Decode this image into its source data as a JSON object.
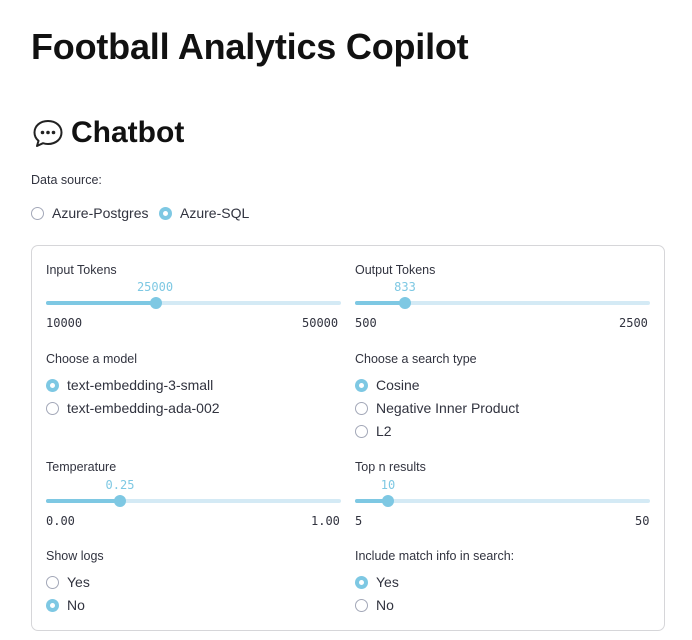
{
  "app_title": "Football Analytics Copilot",
  "section_title": "Chatbot",
  "section_icon": "speech-bubble-icon",
  "colors": {
    "accent": "#7ec8e3",
    "track": "#d4eaf5",
    "text": "#31333f",
    "border": "#d6d6d9"
  },
  "data_source": {
    "label": "Data source:",
    "options": [
      "Azure-Postgres",
      "Azure-SQL"
    ],
    "selected": "Azure-SQL"
  },
  "settings": {
    "input_tokens": {
      "label": "Input Tokens",
      "value": "25000",
      "min": "10000",
      "max": "50000",
      "fraction": 0.375
    },
    "output_tokens": {
      "label": "Output Tokens",
      "value": "833",
      "min": "500",
      "max": "2500",
      "fraction": 0.1665
    },
    "model": {
      "label": "Choose a model",
      "options": [
        "text-embedding-3-small",
        "text-embedding-ada-002"
      ],
      "selected": "text-embedding-3-small"
    },
    "search_type": {
      "label": "Choose a search type",
      "options": [
        "Cosine",
        "Negative Inner Product",
        "L2"
      ],
      "selected": "Cosine"
    },
    "temperature": {
      "label": "Temperature",
      "value": "0.25",
      "min": "0.00",
      "max": "1.00",
      "fraction": 0.25
    },
    "top_n": {
      "label": "Top n results",
      "value": "10",
      "min": "5",
      "max": "50",
      "fraction": 0.1111
    },
    "show_logs": {
      "label": "Show logs",
      "options": [
        "Yes",
        "No"
      ],
      "selected": "No"
    },
    "include_match_info": {
      "label": "Include match info in search:",
      "options": [
        "Yes",
        "No"
      ],
      "selected": "Yes"
    }
  }
}
